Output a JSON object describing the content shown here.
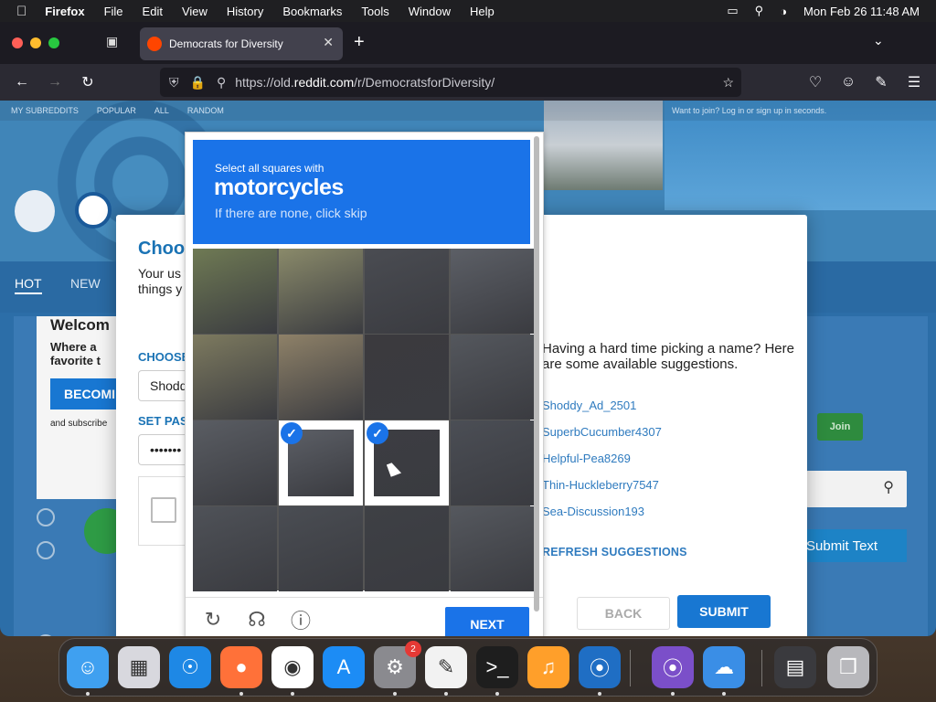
{
  "menubar": {
    "app_name": "Firefox",
    "items": [
      "File",
      "Edit",
      "View",
      "History",
      "Bookmarks",
      "Tools",
      "Window",
      "Help"
    ],
    "datetime": "Mon Feb 26  11:48 AM"
  },
  "browser": {
    "tab_title": "Democrats for Diversity",
    "url_prefix": "https://old.",
    "url_host": "reddit.com",
    "url_path": "/r/DemocratsforDiversity/"
  },
  "page": {
    "top_strip": [
      "MY SUBREDDITS",
      "POPULAR",
      "ALL",
      "RANDOM"
    ],
    "login_text": "Want to join? Log in or sign up in seconds.",
    "tabs": [
      "HOT",
      "NEW"
    ],
    "welcome_title": "Welcom",
    "welcome_sub": "Where a favorite t",
    "become_label": "BECOMI",
    "and_subscribe": "and subscribe",
    "join_label": "Join",
    "submit_text_label": "Submit Text"
  },
  "modal": {
    "heading": "Choo",
    "para": "Your us will see things y you?",
    "choose_label": "CHOOSE",
    "username_value": "Shodd",
    "set_password_label": "SET PAS",
    "password_value": "•••••••",
    "hint": "Having a hard time picking a name? Here are some available suggestions.",
    "suggestions": [
      "Shoddy_Ad_2501",
      "SuperbCucumber4307",
      "Helpful-Pea8269",
      "Thin-Huckleberry7547",
      "Sea-Discussion193"
    ],
    "refresh_label": "REFRESH SUGGESTIONS",
    "back_label": "BACK",
    "submit_label": "SUBMIT"
  },
  "captcha": {
    "instruction_small": "Select all squares with",
    "target": "motorcycles",
    "instruction_hint": "If there are none, click skip",
    "next_label": "NEXT",
    "selected_cells": [
      9,
      10
    ]
  },
  "dock": {
    "apps": [
      "Finder",
      "Launchpad",
      "Safari",
      "Firefox",
      "Chrome",
      "App Store",
      "System Settings",
      "TextEdit",
      "Terminal",
      "GarageBand",
      "Visual Studio Code",
      "Visual Studio",
      "Weather",
      "Desktop",
      "Trash"
    ],
    "settings_badge": "2"
  }
}
